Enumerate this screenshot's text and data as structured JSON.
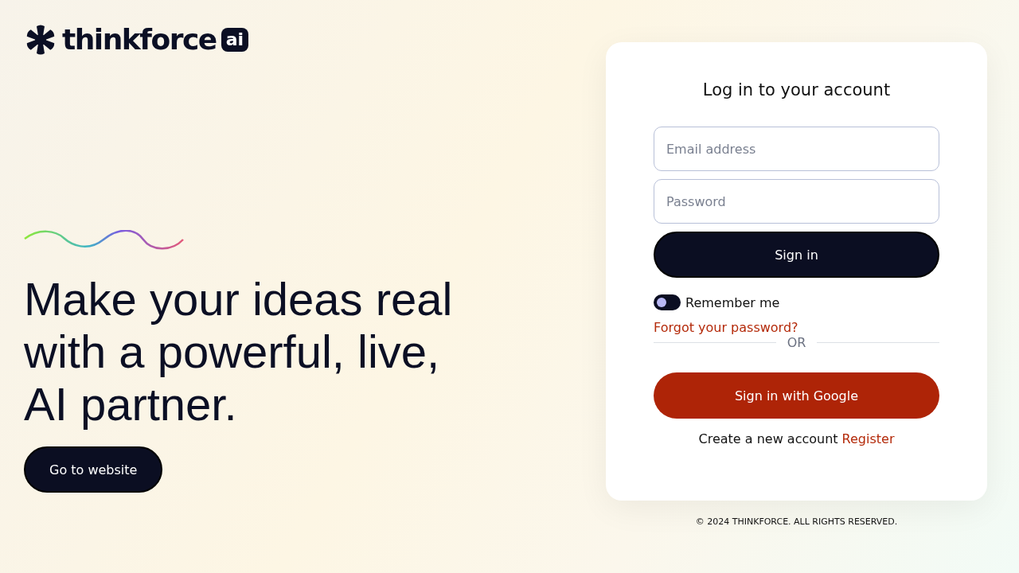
{
  "brand": {
    "name": "thinkforce",
    "badge": "ai"
  },
  "hero": {
    "heading": "Make your ideas real with a powerful, live, AI partner.",
    "button": "Go to website"
  },
  "login": {
    "title": "Log in to your account",
    "fields": [
      {
        "placeholder": "Email address"
      },
      {
        "placeholder": "Password"
      }
    ],
    "submit": "Sign in",
    "remember": {
      "label": "Remember me",
      "on": false
    },
    "forgot": "Forgot your password?",
    "divider": "OR",
    "google": "Sign in with Google",
    "register_prompt": "Create a new account",
    "register_link": "Register"
  },
  "footer": "© 2024 THINKFORCE. ALL RIGHTS RESERVED."
}
